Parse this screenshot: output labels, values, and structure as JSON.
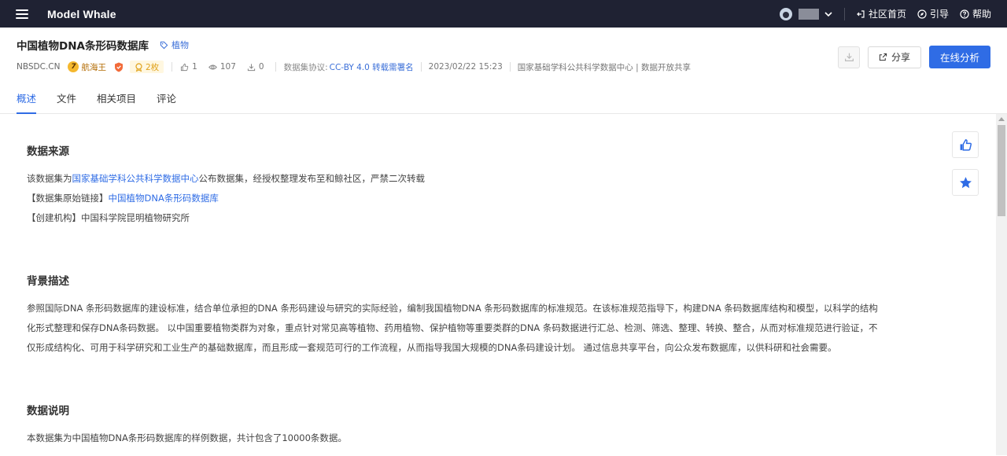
{
  "topbar": {
    "brand": "Model Whale",
    "links": [
      {
        "label": "社区首页",
        "icon": "exit-icon"
      },
      {
        "label": "引导",
        "icon": "compass-icon"
      },
      {
        "label": "帮助",
        "icon": "help-icon"
      }
    ]
  },
  "dataset": {
    "title": "中国植物DNA条形码数据库",
    "tag": "植物",
    "org": "NBSDC.CN",
    "level_number": "7",
    "level_label": "航海王",
    "medals": "2枚",
    "likes": "1",
    "views": "107",
    "downloads": "0",
    "license_label": "数据集协议:",
    "license": "CC-BY 4.0 转载需署名",
    "date": "2023/02/22 15:23",
    "source": "国家基础学科公共科学数据中心 | 数据开放共享"
  },
  "actions": {
    "share": "分享",
    "analyze": "在线分析"
  },
  "tabs": [
    {
      "label": "概述",
      "active": true
    },
    {
      "label": "文件",
      "active": false
    },
    {
      "label": "相关项目",
      "active": false
    },
    {
      "label": "评论",
      "active": false
    }
  ],
  "sections": {
    "source": {
      "title": "数据来源",
      "line1_prefix": "该数据集为",
      "line1_link": "国家基础学科公共科学数据中心",
      "line1_suffix": "公布数据集，经授权整理发布至和鲸社区，严禁二次转载",
      "line2_prefix": "【数据集原始链接】",
      "line2_link": "中国植物DNA条形码数据库",
      "line3": "【创建机构】中国科学院昆明植物研究所"
    },
    "background": {
      "title": "背景描述",
      "lines": [
        "参照国际DNA 条形码数据库的建设标准，结合单位承担的DNA 条形码建设与研究的实际经验，编制我国植物DNA 条形码数据库的标准规范。在该标准规范指导下，构建DNA 条码数据库结构和模型，以科学的结构",
        "化形式整理和保存DNA条码数据。 以中国重要植物类群为对象，重点针对常见高等植物、药用植物、保护植物等重要类群的DNA 条码数据进行汇总、检测、筛选、整理、转换、整合，从而对标准规范进行验证，不",
        "仅形成结构化、可用于科学研究和工业生产的基础数据库，而且形成一套规范可行的工作流程，从而指导我国大规模的DNA条码建设计划。 通过信息共享平台，向公众发布数据库，以供科研和社会需要。"
      ]
    },
    "description": {
      "title": "数据说明",
      "text": "本数据集为中国植物DNA条形码数据库的样例数据，共计包含了10000条数据。"
    }
  },
  "colors": {
    "topbar": "#1f2233",
    "accent": "#2f6ce5",
    "gold": "#f5b82e"
  }
}
